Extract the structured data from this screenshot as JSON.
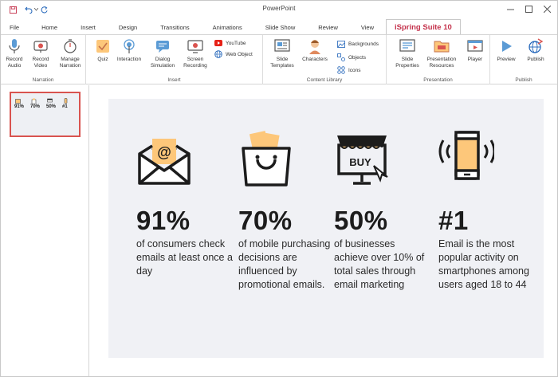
{
  "window": {
    "title": "PowerPoint"
  },
  "quick_access": {
    "save_icon": "save-icon",
    "undo_icon": "undo-icon",
    "undo_dropdown_icon": "chevron-down-icon",
    "redo_icon": "redo-icon"
  },
  "tabs": [
    {
      "label": "File"
    },
    {
      "label": "Home"
    },
    {
      "label": "Insert"
    },
    {
      "label": "Design"
    },
    {
      "label": "Transitions"
    },
    {
      "label": "Animations"
    },
    {
      "label": "Slide Show"
    },
    {
      "label": "Review"
    },
    {
      "label": "View"
    },
    {
      "label": "iSpring Suite 10",
      "active": true
    }
  ],
  "ribbon": {
    "narration": {
      "label": "Narration",
      "record_audio": "Record\nAudio",
      "record_video": "Record\nVideo",
      "manage_narration": "Manage\nNarration"
    },
    "insert": {
      "label": "Insert",
      "quiz": "Quiz",
      "interaction": "Interaction",
      "dialog_simulation": "Dialog\nSimulation",
      "screen_recording": "Screen\nRecording",
      "youtube": "YouTube",
      "web_object": "Web Object"
    },
    "content_library": {
      "label": "Content Library",
      "slide_templates": "Slide\nTemplates",
      "characters": "Characters",
      "backgrounds": "Backgrounds",
      "objects": "Objects",
      "icons": "Icons"
    },
    "presentation": {
      "label": "Presentation",
      "slide_properties": "Slide\nProperties",
      "presentation_resources": "Presentation\nResources",
      "player": "Player"
    },
    "publish": {
      "label": "Publish",
      "preview": "Preview",
      "publish": "Publish"
    }
  },
  "slide": {
    "stats": [
      {
        "value": "91%",
        "description": "of consumers check emails at least once a day",
        "icon": "email-icon"
      },
      {
        "value": "70%",
        "description": "of mobile purchasing decisions are influenced by promotional emails.",
        "icon": "shopping-bag-icon"
      },
      {
        "value": "50%",
        "description": "of businesses achieve over 10% of total sales through email marketing",
        "icon": "buy-store-icon"
      },
      {
        "value": "#1",
        "description": "Email is the most popular activity on smartphones among users aged 18 to 44",
        "icon": "smartphone-icon"
      }
    ]
  },
  "colors": {
    "accent": "#c4314b",
    "icon_orange": "#fdc77a",
    "slide_bg": "#f0f1f5"
  }
}
